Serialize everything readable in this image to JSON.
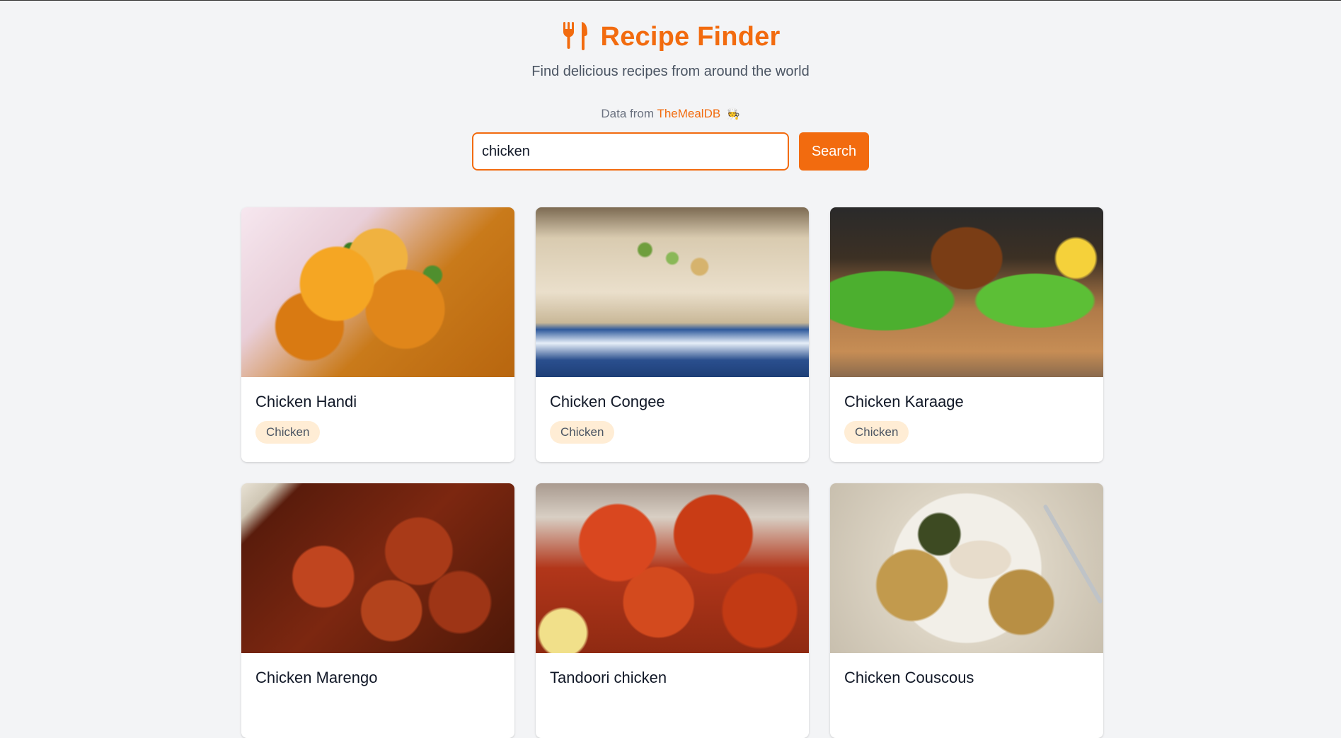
{
  "header": {
    "icon": "fork-knife-icon",
    "title": "Recipe Finder",
    "subtitle": "Find delicious recipes from around the world"
  },
  "attribution": {
    "prefix": "Data from",
    "source": "TheMealDB",
    "emoji": "🧑‍🍳"
  },
  "search": {
    "value": "chicken",
    "placeholder": "",
    "button_label": "Search"
  },
  "colors": {
    "accent": "#f26b0f",
    "badge_bg": "#ffedd5",
    "page_bg": "#f3f4f6"
  },
  "recipes": [
    {
      "title": "Chicken Handi",
      "category": "Chicken"
    },
    {
      "title": "Chicken Congee",
      "category": "Chicken"
    },
    {
      "title": "Chicken Karaage",
      "category": "Chicken"
    },
    {
      "title": "Chicken Marengo",
      "category": ""
    },
    {
      "title": "Tandoori chicken",
      "category": ""
    },
    {
      "title": "Chicken Couscous",
      "category": ""
    }
  ]
}
